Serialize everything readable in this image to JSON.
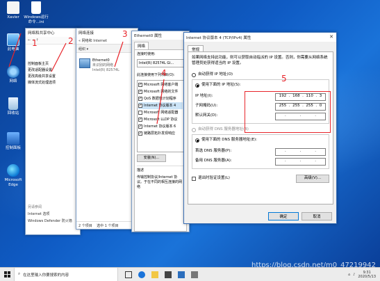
{
  "desktop": {
    "icons": [
      {
        "label": "Xavier"
      },
      {
        "label": "Windows运行命令...ini"
      },
      {
        "label": "此电脑"
      },
      {
        "label": "网络"
      },
      {
        "label": "回收站"
      },
      {
        "label": "控制面板"
      },
      {
        "label": "Microsoft Edge"
      }
    ]
  },
  "center_window": {
    "title": "网络和共享中心",
    "nav": [
      "控制面板主页",
      "更改适配器设置",
      "更改高级共享设置",
      "媒体流式处理选项"
    ],
    "see_also_title": "另请参阅",
    "see_also": [
      "Internet 选项",
      "Windows Defender 防火墙"
    ]
  },
  "conn_window": {
    "title": "网络连接",
    "address": "« 网络和 Internet",
    "toolbar": "组织 ▾",
    "adapter": {
      "name": "Ethernet0",
      "line2": "未识别的网络",
      "line3": "Intel(R) 82574L"
    },
    "status_left": "2 个项目",
    "status_right": "选中 1 个项目"
  },
  "eth_window": {
    "title": "Ethernet0 属性",
    "tab": "网络",
    "connect_using_label": "连接时使用:",
    "nic": "Intel(R) 82574L Gi...",
    "items_label": "此连接使用下列项目(O):",
    "items": [
      {
        "text": "Microsoft 网络客户端",
        "checked": "✓"
      },
      {
        "text": "Microsoft 网络的文件",
        "checked": "✓"
      },
      {
        "text": "QoS 数据包计划程序",
        "checked": "✓"
      },
      {
        "text": "Internet 协议版本 4",
        "checked": "✓"
      },
      {
        "text": "Microsoft 网络适配器",
        "checked": ""
      },
      {
        "text": "Microsoft LLDP 协议",
        "checked": "✓"
      },
      {
        "text": "Internet 协议版本 6",
        "checked": "✓"
      },
      {
        "text": "链路层拓扑发现响应",
        "checked": "✓"
      }
    ],
    "install_button": "安装(N)...",
    "desc_title": "描述",
    "desc_text": "传输控制协议/Internet 协议。于在不同的相互连接的网络"
  },
  "ipv4_dialog": {
    "title": "Internet 协议版本 4 (TCP/IPv4) 属性",
    "close_glyph": "✕",
    "tab": "常规",
    "intro": "如果网络支持此功能，则可以获取自动指派的 IP 设置。否则，你需要从网络系统管理员处获得适当的 IP 设置。",
    "auto_ip": "自动获得 IP 地址(O)",
    "manual_ip": "使用下面的 IP 地址(S):",
    "ip_label": "IP 地址(I):",
    "ip_value": [
      "192",
      "168",
      "110",
      "3"
    ],
    "mask_label": "子网掩码(U):",
    "mask_value": [
      "255",
      "255",
      "255",
      "0"
    ],
    "gateway_label": "默认网关(D):",
    "auto_dns": "自动获得 DNS 服务器地址(B)",
    "manual_dns": "使用下面的 DNS 服务器地址(E):",
    "dns1_label": "首选 DNS 服务器(P):",
    "dns2_label": "备用 DNS 服务器(A):",
    "validate": "退出时验证设置(L)",
    "advanced": "高级(V)...",
    "ok": "确定",
    "cancel": "取消"
  },
  "annotations": {
    "n1": "1",
    "n2": "2",
    "n3": "3",
    "n4": "4",
    "n5": "5"
  },
  "taskbar": {
    "search_placeholder": "在这里输入你要搜索的内容",
    "time": "9:31",
    "date": "2020/5/13"
  },
  "watermark": "https://blog.csdn.net/m0_47219942",
  "colors": {
    "annotation": "#e8242a",
    "desktop": "#0f5bc4"
  }
}
